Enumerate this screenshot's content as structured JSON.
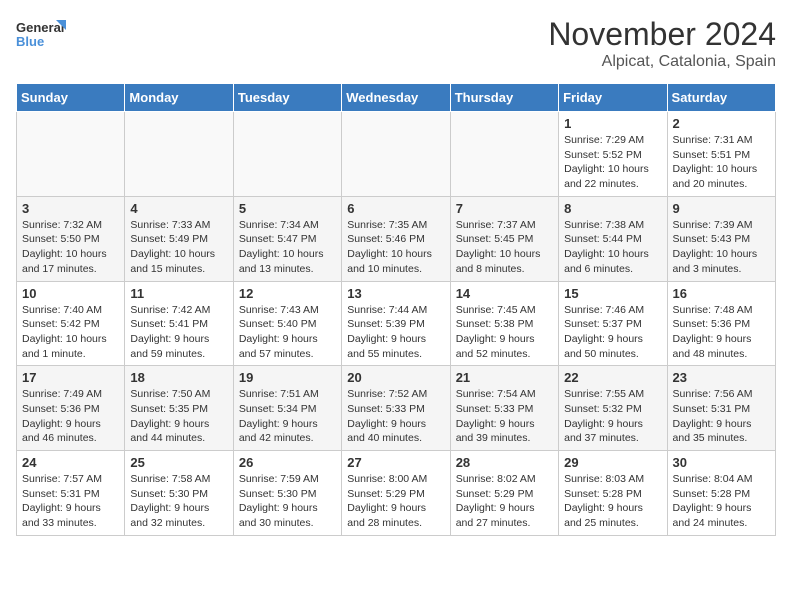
{
  "logo": {
    "line1": "General",
    "line2": "Blue"
  },
  "title": "November 2024",
  "location": "Alpicat, Catalonia, Spain",
  "weekdays": [
    "Sunday",
    "Monday",
    "Tuesday",
    "Wednesday",
    "Thursday",
    "Friday",
    "Saturday"
  ],
  "weeks": [
    [
      {
        "day": "",
        "info": ""
      },
      {
        "day": "",
        "info": ""
      },
      {
        "day": "",
        "info": ""
      },
      {
        "day": "",
        "info": ""
      },
      {
        "day": "",
        "info": ""
      },
      {
        "day": "1",
        "info": "Sunrise: 7:29 AM\nSunset: 5:52 PM\nDaylight: 10 hours\nand 22 minutes."
      },
      {
        "day": "2",
        "info": "Sunrise: 7:31 AM\nSunset: 5:51 PM\nDaylight: 10 hours\nand 20 minutes."
      }
    ],
    [
      {
        "day": "3",
        "info": "Sunrise: 7:32 AM\nSunset: 5:50 PM\nDaylight: 10 hours\nand 17 minutes."
      },
      {
        "day": "4",
        "info": "Sunrise: 7:33 AM\nSunset: 5:49 PM\nDaylight: 10 hours\nand 15 minutes."
      },
      {
        "day": "5",
        "info": "Sunrise: 7:34 AM\nSunset: 5:47 PM\nDaylight: 10 hours\nand 13 minutes."
      },
      {
        "day": "6",
        "info": "Sunrise: 7:35 AM\nSunset: 5:46 PM\nDaylight: 10 hours\nand 10 minutes."
      },
      {
        "day": "7",
        "info": "Sunrise: 7:37 AM\nSunset: 5:45 PM\nDaylight: 10 hours\nand 8 minutes."
      },
      {
        "day": "8",
        "info": "Sunrise: 7:38 AM\nSunset: 5:44 PM\nDaylight: 10 hours\nand 6 minutes."
      },
      {
        "day": "9",
        "info": "Sunrise: 7:39 AM\nSunset: 5:43 PM\nDaylight: 10 hours\nand 3 minutes."
      }
    ],
    [
      {
        "day": "10",
        "info": "Sunrise: 7:40 AM\nSunset: 5:42 PM\nDaylight: 10 hours\nand 1 minute."
      },
      {
        "day": "11",
        "info": "Sunrise: 7:42 AM\nSunset: 5:41 PM\nDaylight: 9 hours\nand 59 minutes."
      },
      {
        "day": "12",
        "info": "Sunrise: 7:43 AM\nSunset: 5:40 PM\nDaylight: 9 hours\nand 57 minutes."
      },
      {
        "day": "13",
        "info": "Sunrise: 7:44 AM\nSunset: 5:39 PM\nDaylight: 9 hours\nand 55 minutes."
      },
      {
        "day": "14",
        "info": "Sunrise: 7:45 AM\nSunset: 5:38 PM\nDaylight: 9 hours\nand 52 minutes."
      },
      {
        "day": "15",
        "info": "Sunrise: 7:46 AM\nSunset: 5:37 PM\nDaylight: 9 hours\nand 50 minutes."
      },
      {
        "day": "16",
        "info": "Sunrise: 7:48 AM\nSunset: 5:36 PM\nDaylight: 9 hours\nand 48 minutes."
      }
    ],
    [
      {
        "day": "17",
        "info": "Sunrise: 7:49 AM\nSunset: 5:36 PM\nDaylight: 9 hours\nand 46 minutes."
      },
      {
        "day": "18",
        "info": "Sunrise: 7:50 AM\nSunset: 5:35 PM\nDaylight: 9 hours\nand 44 minutes."
      },
      {
        "day": "19",
        "info": "Sunrise: 7:51 AM\nSunset: 5:34 PM\nDaylight: 9 hours\nand 42 minutes."
      },
      {
        "day": "20",
        "info": "Sunrise: 7:52 AM\nSunset: 5:33 PM\nDaylight: 9 hours\nand 40 minutes."
      },
      {
        "day": "21",
        "info": "Sunrise: 7:54 AM\nSunset: 5:33 PM\nDaylight: 9 hours\nand 39 minutes."
      },
      {
        "day": "22",
        "info": "Sunrise: 7:55 AM\nSunset: 5:32 PM\nDaylight: 9 hours\nand 37 minutes."
      },
      {
        "day": "23",
        "info": "Sunrise: 7:56 AM\nSunset: 5:31 PM\nDaylight: 9 hours\nand 35 minutes."
      }
    ],
    [
      {
        "day": "24",
        "info": "Sunrise: 7:57 AM\nSunset: 5:31 PM\nDaylight: 9 hours\nand 33 minutes."
      },
      {
        "day": "25",
        "info": "Sunrise: 7:58 AM\nSunset: 5:30 PM\nDaylight: 9 hours\nand 32 minutes."
      },
      {
        "day": "26",
        "info": "Sunrise: 7:59 AM\nSunset: 5:30 PM\nDaylight: 9 hours\nand 30 minutes."
      },
      {
        "day": "27",
        "info": "Sunrise: 8:00 AM\nSunset: 5:29 PM\nDaylight: 9 hours\nand 28 minutes."
      },
      {
        "day": "28",
        "info": "Sunrise: 8:02 AM\nSunset: 5:29 PM\nDaylight: 9 hours\nand 27 minutes."
      },
      {
        "day": "29",
        "info": "Sunrise: 8:03 AM\nSunset: 5:28 PM\nDaylight: 9 hours\nand 25 minutes."
      },
      {
        "day": "30",
        "info": "Sunrise: 8:04 AM\nSunset: 5:28 PM\nDaylight: 9 hours\nand 24 minutes."
      }
    ]
  ]
}
